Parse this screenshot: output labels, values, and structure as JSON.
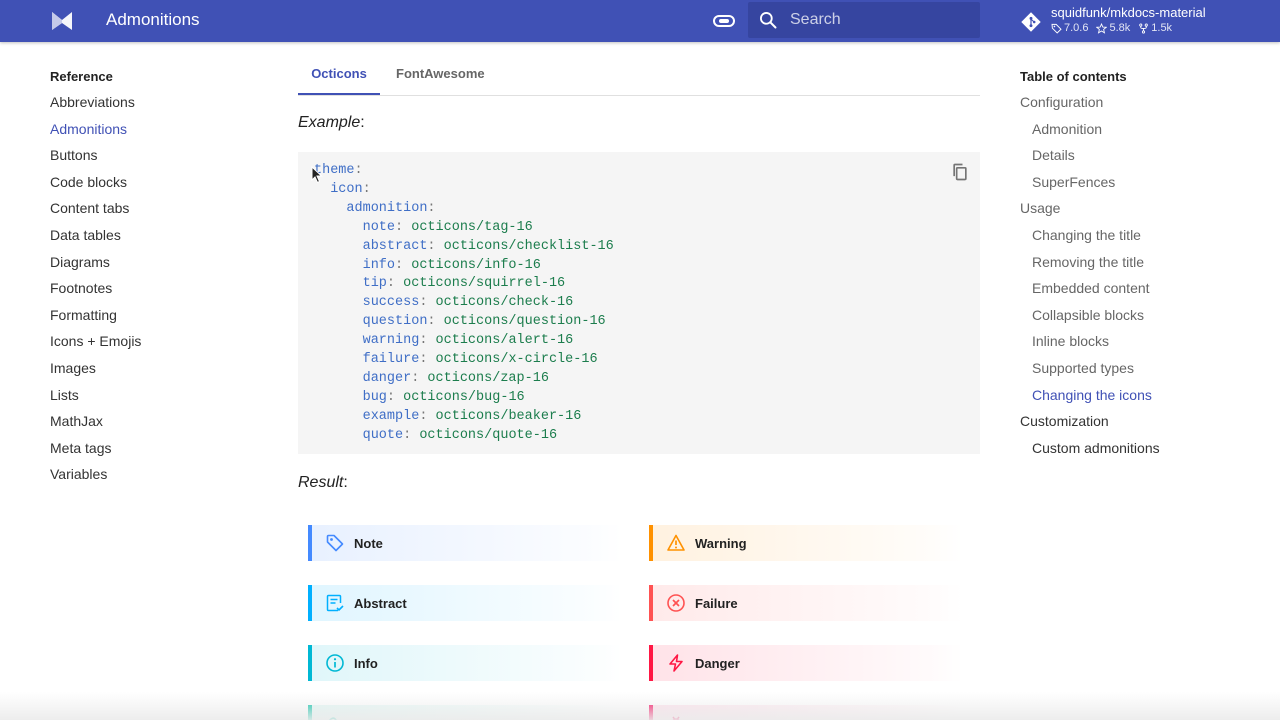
{
  "header": {
    "site_title": "Admonitions",
    "search_placeholder": "Search",
    "repo": {
      "name": "squidfunk/mkdocs-material",
      "version": "7.0.6",
      "stars": "5.8k",
      "forks": "1.5k"
    }
  },
  "nav": {
    "title": "Reference",
    "items": [
      {
        "label": "Abbreviations"
      },
      {
        "label": "Admonitions",
        "active": true
      },
      {
        "label": "Buttons"
      },
      {
        "label": "Code blocks"
      },
      {
        "label": "Content tabs"
      },
      {
        "label": "Data tables"
      },
      {
        "label": "Diagrams"
      },
      {
        "label": "Footnotes"
      },
      {
        "label": "Formatting"
      },
      {
        "label": "Icons + Emojis"
      },
      {
        "label": "Images"
      },
      {
        "label": "Lists"
      },
      {
        "label": "MathJax"
      },
      {
        "label": "Meta tags"
      },
      {
        "label": "Variables"
      }
    ]
  },
  "toc": {
    "title": "Table of contents",
    "items": [
      {
        "label": "Configuration"
      },
      {
        "label": "Admonition"
      },
      {
        "label": "Details"
      },
      {
        "label": "SuperFences"
      },
      {
        "label": "Usage"
      },
      {
        "label": "Changing the title"
      },
      {
        "label": "Removing the title"
      },
      {
        "label": "Embedded content"
      },
      {
        "label": "Collapsible blocks"
      },
      {
        "label": "Inline blocks"
      },
      {
        "label": "Supported types"
      },
      {
        "label": "Changing the icons"
      },
      {
        "label": "Customization"
      },
      {
        "label": "Custom admonitions"
      }
    ]
  },
  "main": {
    "tabs": [
      {
        "label": "Octicons",
        "active": true
      },
      {
        "label": "FontAwesome"
      }
    ],
    "example_label": "Example",
    "result_label": "Result",
    "code": {
      "theme": "theme",
      "icon": "icon",
      "admonition": "admonition",
      "entries": [
        {
          "key": "note",
          "value": "octicons/tag-16"
        },
        {
          "key": "abstract",
          "value": "octicons/checklist-16"
        },
        {
          "key": "info",
          "value": "octicons/info-16"
        },
        {
          "key": "tip",
          "value": "octicons/squirrel-16"
        },
        {
          "key": "success",
          "value": "octicons/check-16"
        },
        {
          "key": "question",
          "value": "octicons/question-16"
        },
        {
          "key": "warning",
          "value": "octicons/alert-16"
        },
        {
          "key": "failure",
          "value": "octicons/x-circle-16"
        },
        {
          "key": "danger",
          "value": "octicons/zap-16"
        },
        {
          "key": "bug",
          "value": "octicons/bug-16"
        },
        {
          "key": "example",
          "value": "octicons/beaker-16"
        },
        {
          "key": "quote",
          "value": "octicons/quote-16"
        }
      ]
    },
    "admonitions": {
      "note": {
        "title": "Note",
        "color": "#448aff"
      },
      "abstract": {
        "title": "Abstract",
        "color": "#00b0ff"
      },
      "info": {
        "title": "Info",
        "color": "#00b8d4"
      },
      "warning": {
        "title": "Warning",
        "color": "#ff9100"
      },
      "failure": {
        "title": "Failure",
        "color": "#ff5252"
      },
      "danger": {
        "title": "Danger",
        "color": "#ff1744"
      }
    }
  },
  "colors": {
    "primary": "#4051b5",
    "code_key": "#3f6ec6",
    "code_value": "#1c7d4d"
  },
  "icons": {
    "logo": "material-logo-icon",
    "palette": "toggle-icon",
    "search": "search-icon",
    "repo": "git-icon",
    "copy": "copy-icon"
  }
}
